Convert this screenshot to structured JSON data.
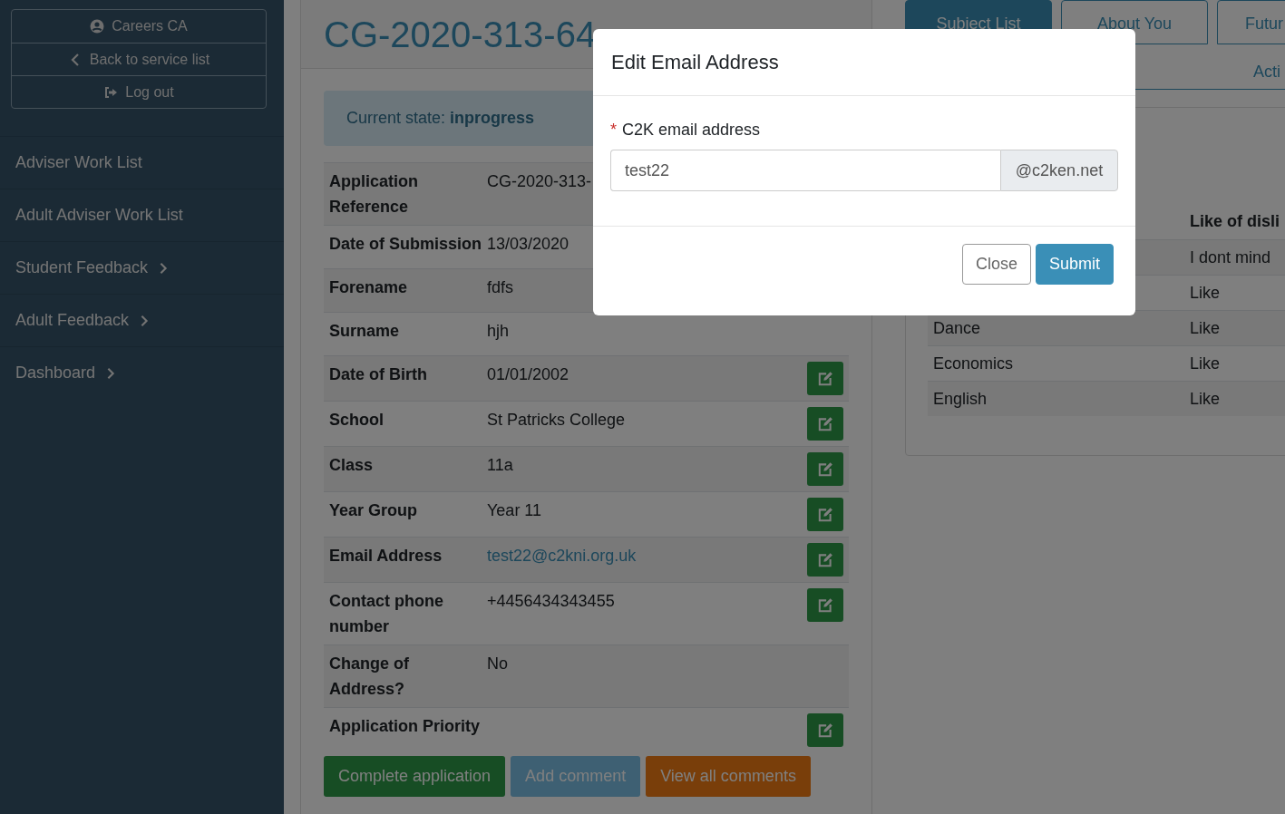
{
  "sidebar": {
    "account_buttons": [
      {
        "kind": "user",
        "label": "Careers CA"
      },
      {
        "kind": "back",
        "label": "Back to service list"
      },
      {
        "kind": "logout",
        "label": "Log out"
      }
    ],
    "nav_items": [
      {
        "label": "Adviser Work List",
        "has_submenu": false
      },
      {
        "label": "Adult Adviser Work List",
        "has_submenu": false
      },
      {
        "label": "Student Feedback",
        "has_submenu": true
      },
      {
        "label": "Adult Feedback",
        "has_submenu": true
      },
      {
        "label": "Dashboard",
        "has_submenu": true
      }
    ]
  },
  "application": {
    "title": "CG-2020-313-64",
    "state": "Current state: **inprogress**",
    "fields": [
      {
        "label": "Application Reference",
        "value": "CG-2020-313-",
        "kind": "text",
        "editable": false
      },
      {
        "label": "Date of Submission",
        "value": "13/03/2020",
        "kind": "text",
        "editable": false
      },
      {
        "label": "Forename",
        "value": "fdfs",
        "kind": "text",
        "editable": false
      },
      {
        "label": "Surname",
        "value": "hjh",
        "kind": "text",
        "editable": false
      },
      {
        "label": "Date of Birth",
        "value": "01/01/2002",
        "kind": "text",
        "editable": true
      },
      {
        "label": "School",
        "value": "St Patricks College",
        "kind": "text",
        "editable": true
      },
      {
        "label": "Class",
        "value": "11a",
        "kind": "text",
        "editable": true
      },
      {
        "label": "Year Group",
        "value": "Year 11",
        "kind": "text",
        "editable": true
      },
      {
        "label": "Email Address",
        "value": "test22@c2kni.org.uk",
        "kind": "link",
        "editable": true
      },
      {
        "label": "Contact phone number",
        "value": "+4456434343455",
        "kind": "text",
        "editable": true
      },
      {
        "label": "Change of Address?",
        "value": "No",
        "kind": "text",
        "editable": false
      },
      {
        "label": "Application Priority",
        "kind": "text",
        "editable": true
      }
    ],
    "actions": [
      {
        "label": "Complete application",
        "kind": "success"
      },
      {
        "label": "Add comment",
        "kind": "info"
      },
      {
        "label": "View all comments",
        "kind": "warning"
      }
    ]
  },
  "tabs": [
    {
      "label": "Subiect List",
      "selected": true
    },
    {
      "label": "About You",
      "selected": false
    },
    {
      "label": "Futur",
      "selected": false
    }
  ],
  "tabs_row_2": [
    {
      "label": "Acti",
      "selected": false
    }
  ],
  "subject_table": {
    "column_2": "Like of disli",
    "rows": [
      {
        "column_2": "I dont mind"
      },
      {
        "column_2": "Like"
      },
      {
        "subject": "Dance",
        "column_2": "Like"
      },
      {
        "subject": "Economics",
        "column_2": "Like"
      },
      {
        "subject": "English",
        "column_2": "Like"
      }
    ]
  },
  "modal": {
    "title": "Edit Email Address",
    "field": {
      "label": "C2K email address",
      "required_mark": "*",
      "value": "test22",
      "suffix": "@c2ken.net"
    },
    "buttons": [
      {
        "label": "Close",
        "kind": "secondary"
      },
      {
        "label": "Submit",
        "kind": "primary"
      }
    ]
  }
}
